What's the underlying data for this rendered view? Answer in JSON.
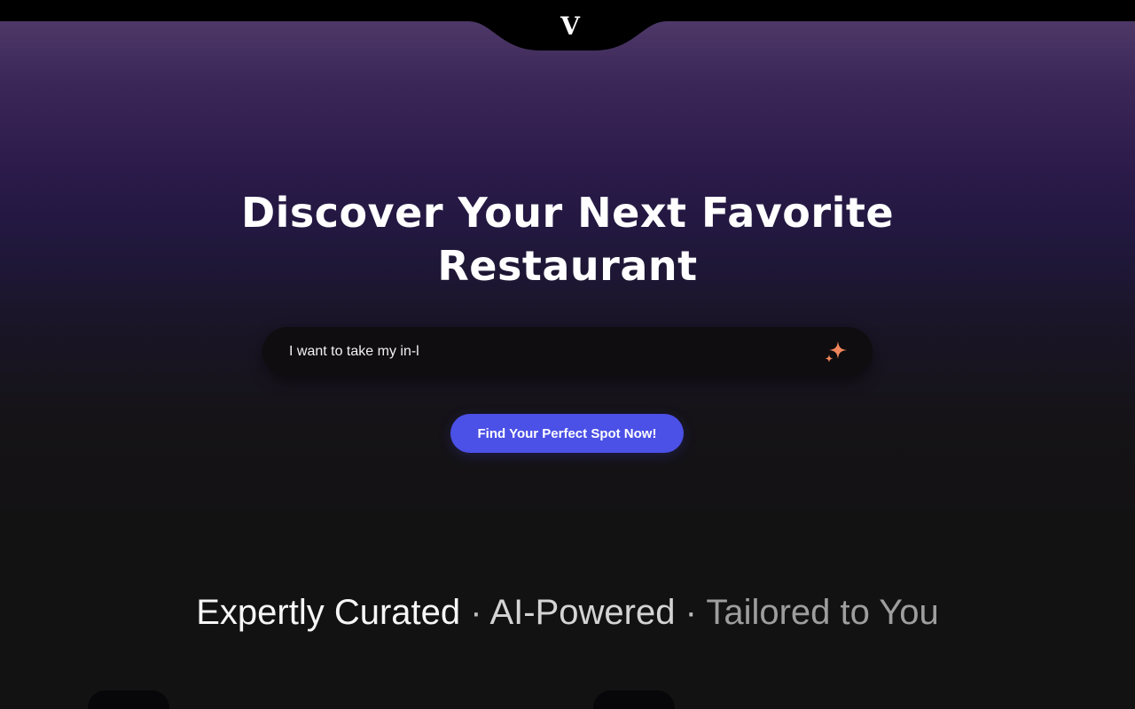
{
  "header": {
    "logo_text": "V"
  },
  "hero": {
    "headline": "Discover Your Next Favorite Restaurant",
    "search": {
      "value": "I want to take my in-l",
      "placeholder": ""
    },
    "cta_label": "Find Your Perfect Spot Now!"
  },
  "tagline": {
    "part1": "Expertly Curated",
    "separator": "·",
    "part2": "AI-Powered",
    "part3": "Tailored to You"
  },
  "icons": {
    "logo": "logo-v-icon",
    "search_action": "sparkle-icon"
  },
  "colors": {
    "accent": "#4b50e6",
    "sparkle": "#f0855b",
    "hero_top": "#4d3868",
    "background": "#131213"
  }
}
